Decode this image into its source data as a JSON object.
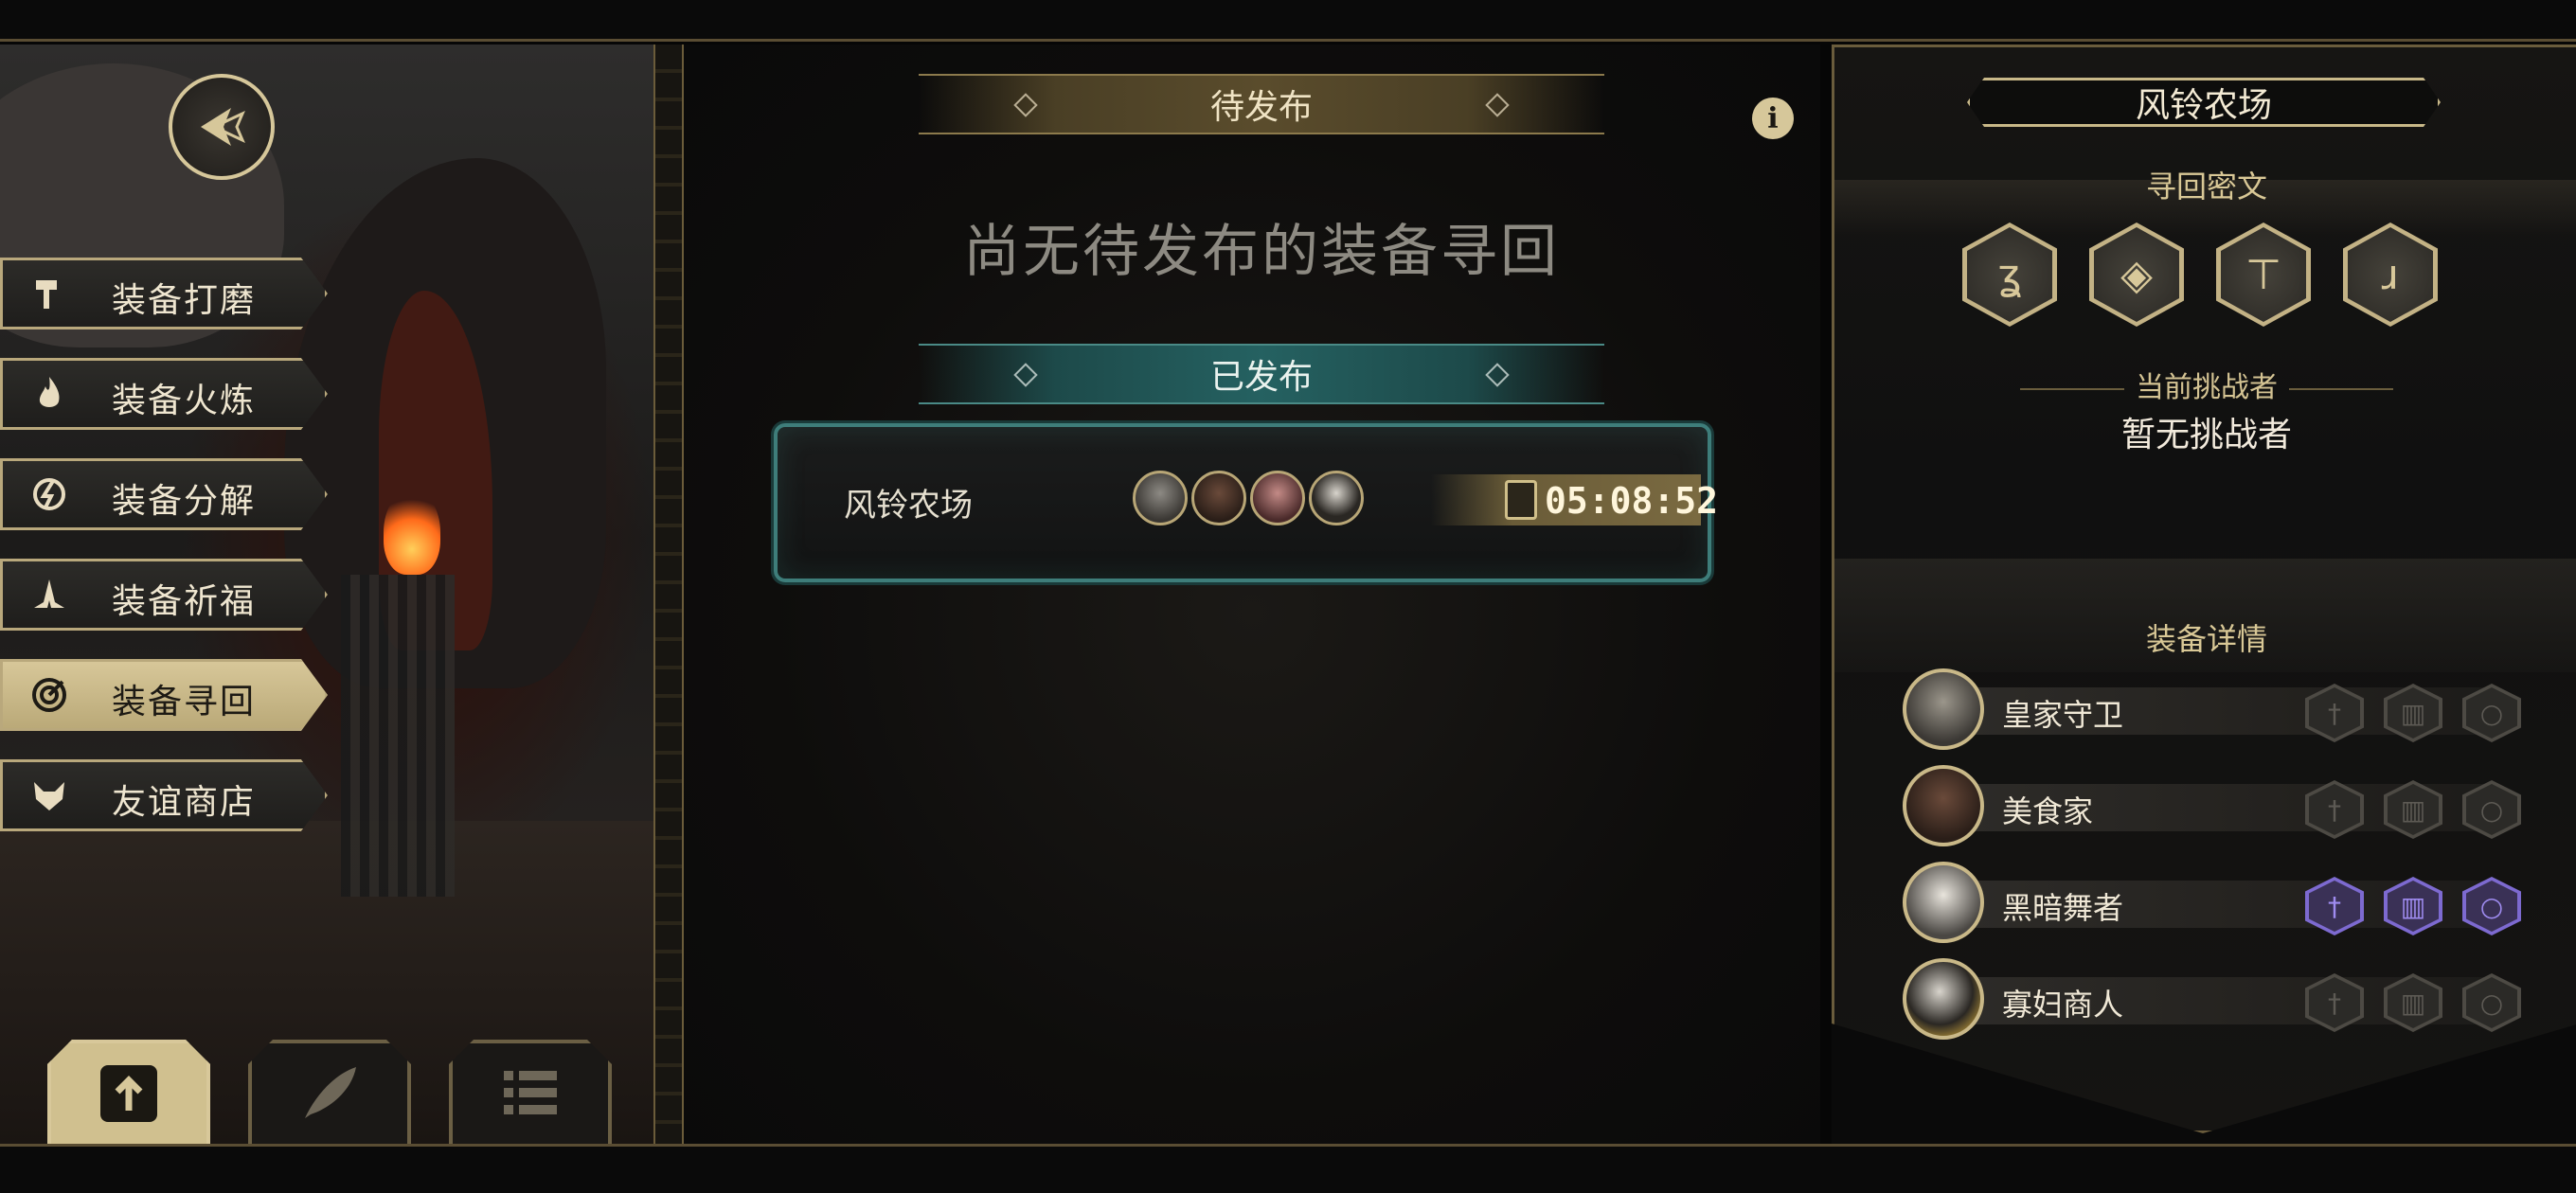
{
  "left_menu": {
    "items": [
      {
        "label": "装备打磨",
        "icon": "hammer-icon",
        "active": false
      },
      {
        "label": "装备火炼",
        "icon": "flame-icon",
        "active": false
      },
      {
        "label": "装备分解",
        "icon": "decompose-icon",
        "active": false
      },
      {
        "label": "装备祈福",
        "icon": "prayer-hands-icon",
        "active": false
      },
      {
        "label": "装备寻回",
        "icon": "target-icon",
        "active": true
      },
      {
        "label": "友谊商店",
        "icon": "fox-shop-icon",
        "active": false
      }
    ],
    "bottom_tabs": [
      {
        "icon": "upload-document-icon",
        "active": true
      },
      {
        "icon": "feather-icon",
        "active": false
      },
      {
        "icon": "list-icon",
        "active": false
      }
    ]
  },
  "center": {
    "pending_banner": "待发布",
    "pending_empty": "尚无待发布的装备寻回",
    "published_banner": "已发布",
    "published": [
      {
        "name": "风铃农场",
        "timer": "05:08:52",
        "avatars": 4
      }
    ]
  },
  "right_panel": {
    "title": "风铃农场",
    "cipher_label": "寻回密文",
    "challenger_label": "当前挑战者",
    "challenger_value": "暂无挑战者",
    "details_label": "装备详情",
    "heroes": [
      {
        "name": "皇家守卫",
        "highlight": false
      },
      {
        "name": "美食家",
        "highlight": false
      },
      {
        "name": "黑暗舞者",
        "highlight": true
      },
      {
        "name": "寡妇商人",
        "highlight": false
      }
    ]
  },
  "colors": {
    "gold": "#d6c79a",
    "teal": "#3e7d7a",
    "purple_slot": "#7d6ad0"
  }
}
